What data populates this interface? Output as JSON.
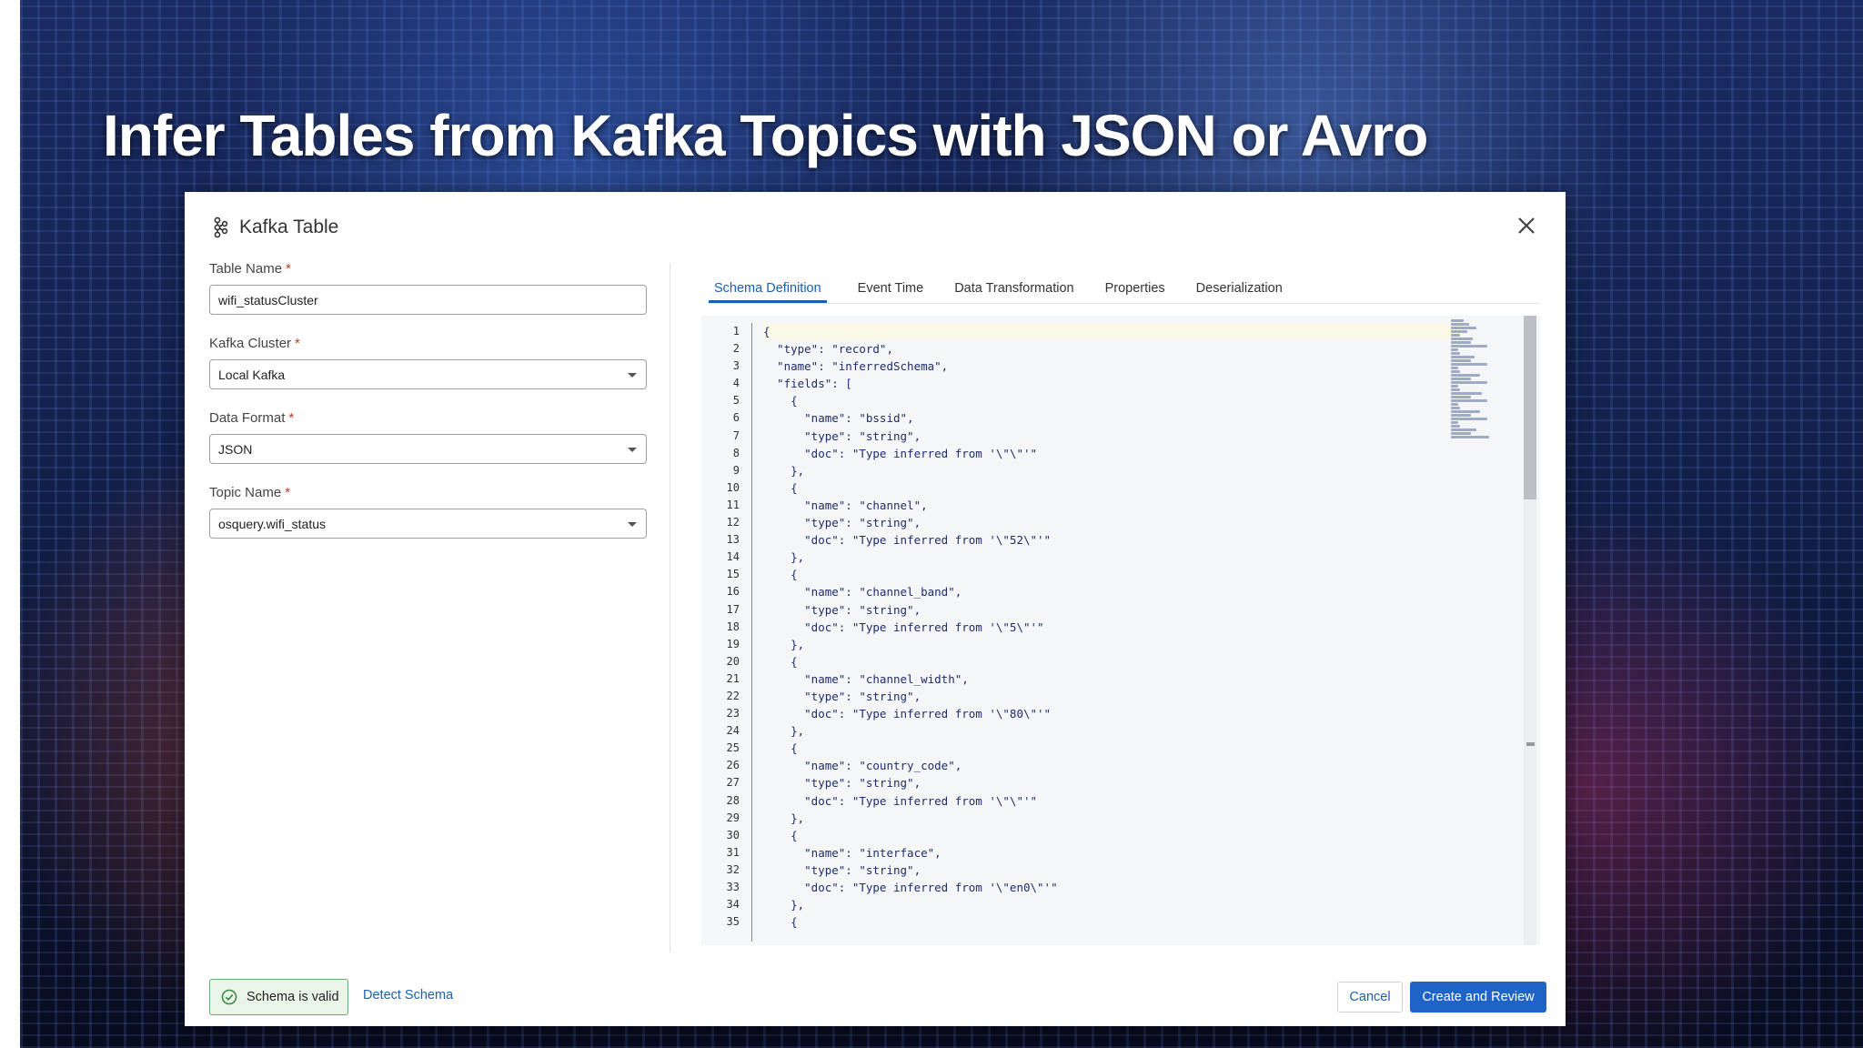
{
  "slide": {
    "title": "Infer Tables from Kafka Topics with JSON or Avro"
  },
  "dialog": {
    "title": "Kafka Table",
    "icon": "kafka-icon",
    "close_icon": "close-icon"
  },
  "form": {
    "table_name": {
      "label": "Table Name",
      "required": "*",
      "value": "wifi_statusCluster"
    },
    "kafka_cluster": {
      "label": "Kafka Cluster",
      "required": "*",
      "value": "Local Kafka"
    },
    "data_format": {
      "label": "Data Format",
      "required": "*",
      "value": "JSON"
    },
    "topic_name": {
      "label": "Topic Name",
      "required": "*",
      "value": "osquery.wifi_status"
    }
  },
  "tabs": [
    {
      "label": "Schema Definition",
      "active": true
    },
    {
      "label": "Event Time"
    },
    {
      "label": "Data Transformation"
    },
    {
      "label": "Properties"
    },
    {
      "label": "Deserialization"
    }
  ],
  "editor": {
    "line_numbers": [
      "1",
      "2",
      "3",
      "4",
      "5",
      "6",
      "7",
      "8",
      "9",
      "10",
      "11",
      "12",
      "13",
      "14",
      "15",
      "16",
      "17",
      "18",
      "19",
      "20",
      "21",
      "22",
      "23",
      "24",
      "25",
      "26",
      "27",
      "28",
      "29",
      "30",
      "31",
      "32",
      "33",
      "34",
      "35"
    ],
    "lines": [
      "{",
      "  \"type\": \"record\",",
      "  \"name\": \"inferredSchema\",",
      "  \"fields\": [",
      "    {",
      "      \"name\": \"bssid\",",
      "      \"type\": \"string\",",
      "      \"doc\": \"Type inferred from '\\\"\\\"'\"",
      "    },",
      "    {",
      "      \"name\": \"channel\",",
      "      \"type\": \"string\",",
      "      \"doc\": \"Type inferred from '\\\"52\\\"'\"",
      "    },",
      "    {",
      "      \"name\": \"channel_band\",",
      "      \"type\": \"string\",",
      "      \"doc\": \"Type inferred from '\\\"5\\\"'\"",
      "    },",
      "    {",
      "      \"name\": \"channel_width\",",
      "      \"type\": \"string\",",
      "      \"doc\": \"Type inferred from '\\\"80\\\"'\"",
      "    },",
      "    {",
      "      \"name\": \"country_code\",",
      "      \"type\": \"string\",",
      "      \"doc\": \"Type inferred from '\\\"\\\"'\"",
      "    },",
      "    {",
      "      \"name\": \"interface\",",
      "      \"type\": \"string\",",
      "      \"doc\": \"Type inferred from '\\\"en0\\\"'\"",
      "    },",
      "    {"
    ]
  },
  "footer": {
    "status": "Schema is valid",
    "status_icon": "check-circle-icon",
    "detect_link": "Detect Schema",
    "cancel": "Cancel",
    "create": "Create and Review"
  },
  "colors": {
    "accent": "#1f63c6",
    "link": "#1a5fb4",
    "valid_bg": "#eaf5ea",
    "valid_border": "#6aa86d"
  }
}
